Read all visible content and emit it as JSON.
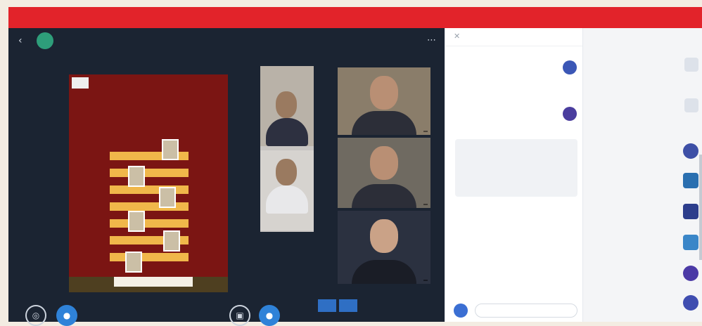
{
  "banner": {
    "text": ""
  },
  "conference": {
    "title": "",
    "logo_initial": "",
    "tiles": [
      {
        "name": ""
      },
      {
        "name": ""
      },
      {
        "name": ""
      }
    ],
    "controls": {
      "settings_icon": "gear-icon",
      "camera_icon": "camera-icon",
      "share_icon": "screen-share-icon",
      "mic_icon": "mic-icon"
    }
  },
  "presentation": {
    "badge": "",
    "title": "",
    "caption": ""
  },
  "chat": {
    "title": "",
    "close_icon": "close-icon",
    "messages": [
      {
        "name": "",
        "text": ""
      },
      {
        "name": "",
        "text": ""
      }
    ],
    "card_line1": "",
    "card_line2": "",
    "input_placeholder": ""
  },
  "people": {
    "section1": "",
    "section2": "",
    "section3": "",
    "items": [
      {
        "name": "",
        "sub": ""
      },
      {
        "name": "",
        "sub": ""
      },
      {
        "name": "",
        "sub": ""
      },
      {
        "name": "",
        "sub": ""
      },
      {
        "name": "",
        "sub": ""
      },
      {
        "name": "",
        "sub": ""
      },
      {
        "name": "",
        "sub": ""
      },
      {
        "name": "",
        "sub": ""
      }
    ]
  },
  "colors": {
    "banner": "#e2232a",
    "stage": "#1b2432",
    "accent": "#2f82d8"
  }
}
